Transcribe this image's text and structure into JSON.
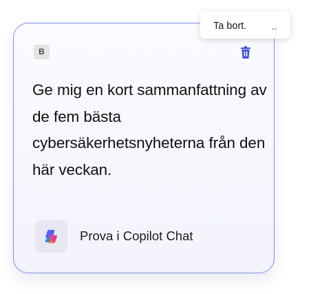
{
  "card": {
    "author_initial": "B",
    "prompt_text": "Ge mig en kort sammanfattning av de fem bästa cybersäkerhetsnyheterna från den här veckan.",
    "action_label": "Prova i Copilot Chat",
    "delete_icon": "trash-icon",
    "app_icon": "copilot-icon"
  },
  "context_menu": {
    "remove_label": "Ta bort.",
    "more_label": ".."
  },
  "colors": {
    "card_border": "#7d8ce6",
    "trash_icon": "#3d4fd8",
    "card_background": "#f6f7fd"
  }
}
